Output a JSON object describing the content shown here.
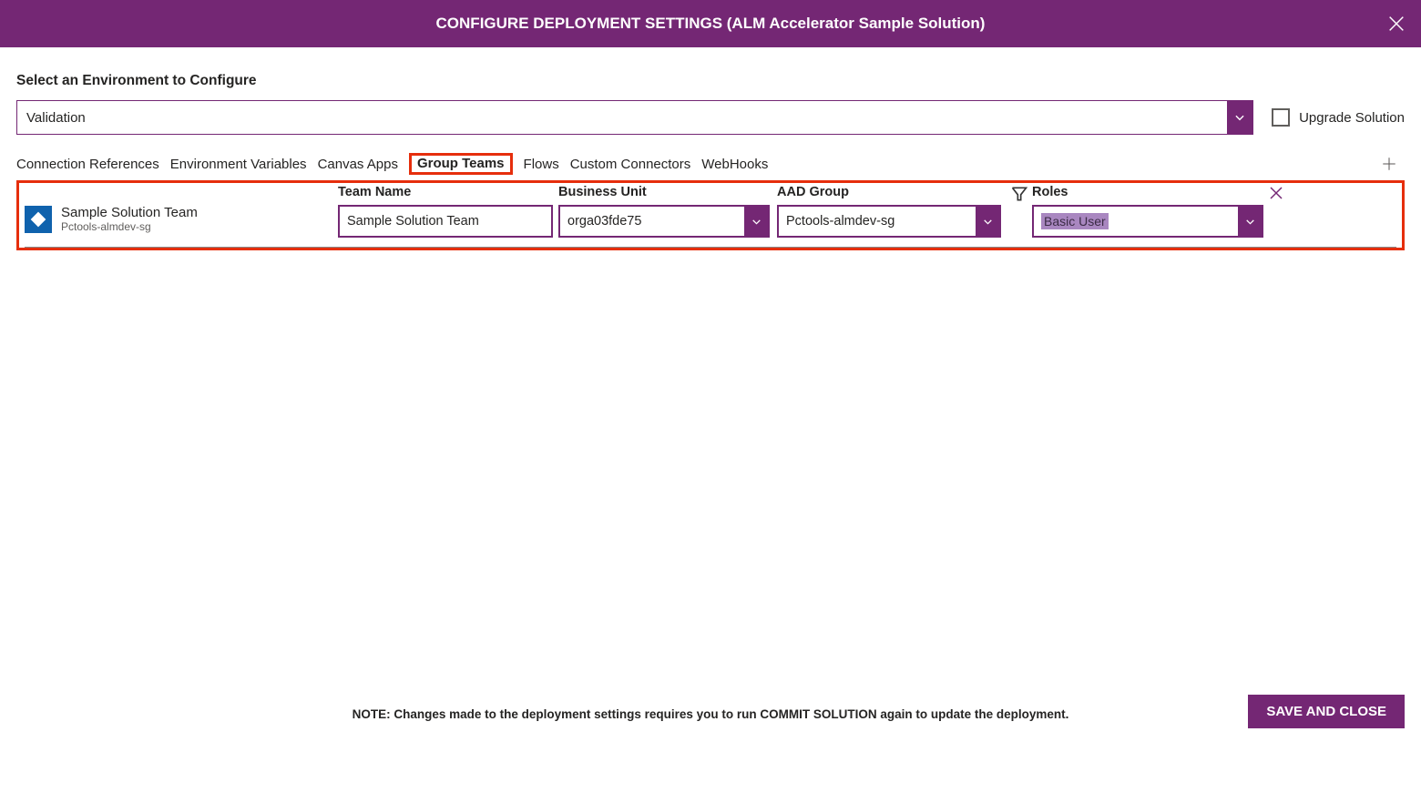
{
  "header": {
    "title": "CONFIGURE DEPLOYMENT SETTINGS (ALM Accelerator Sample Solution)"
  },
  "env": {
    "label": "Select an Environment to Configure",
    "selected": "Validation",
    "upgrade_label": "Upgrade Solution"
  },
  "tabs": {
    "items": [
      {
        "label": "Connection References"
      },
      {
        "label": "Environment Variables"
      },
      {
        "label": "Canvas Apps"
      },
      {
        "label": "Group Teams",
        "active": true
      },
      {
        "label": "Flows"
      },
      {
        "label": "Custom Connectors"
      },
      {
        "label": "WebHooks"
      }
    ]
  },
  "grid": {
    "headers": {
      "team_name": "Team Name",
      "business_unit": "Business Unit",
      "aad_group": "AAD Group",
      "roles": "Roles"
    },
    "rows": [
      {
        "display_name": "Sample Solution Team",
        "display_sub": "Pctools-almdev-sg",
        "team_name_value": "Sample Solution Team",
        "business_unit_value": "orga03fde75",
        "aad_group_value": "Pctools-almdev-sg",
        "roles_value": "Basic User"
      }
    ]
  },
  "footer": {
    "note": "NOTE: Changes made to the deployment settings requires you to run COMMIT SOLUTION again to update the deployment.",
    "save_label": "SAVE AND CLOSE"
  }
}
